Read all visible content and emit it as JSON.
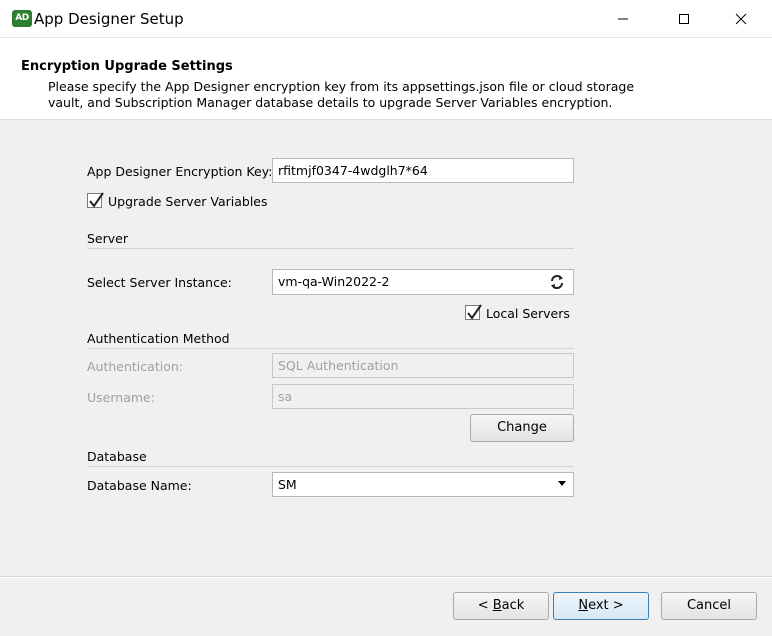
{
  "window": {
    "icon_text": "AD",
    "title": "App Designer Setup"
  },
  "header": {
    "title": "Encryption Upgrade Settings",
    "description_line1": "Please specify the App Designer encryption key from its appsettings.json file or cloud storage",
    "description_line2": "vault, and Subscription Manager database details to upgrade Server Variables encryption."
  },
  "form": {
    "encryption_key": {
      "label": "App Designer Encryption Key:",
      "value": "rfitmjf0347-4wdglh7*64"
    },
    "upgrade_server_variables": {
      "label": "Upgrade Server Variables",
      "checked": true
    },
    "server_section": "Server",
    "server_instance": {
      "label": "Select Server Instance:",
      "value": "vm-qa-Win2022-2",
      "icon": "refresh-icon"
    },
    "local_servers": {
      "label": "Local Servers",
      "checked": true
    },
    "auth_section": "Authentication Method",
    "authentication": {
      "label": "Authentication:",
      "value": "SQL Authentication"
    },
    "username": {
      "label": "Username:",
      "value": "sa"
    },
    "change_button": "Change",
    "database_section": "Database",
    "database_name": {
      "label": "Database Name:",
      "value": "SM"
    }
  },
  "footer": {
    "back_prefix": "< ",
    "back_accel": "B",
    "back_rest": "ack",
    "next_accel": "N",
    "next_rest": "ext >",
    "cancel": "Cancel"
  },
  "colors": {
    "app_icon": "#2e7d32",
    "default_button_border": "#3c7fb1",
    "panel_background": "#f0f0f0"
  }
}
